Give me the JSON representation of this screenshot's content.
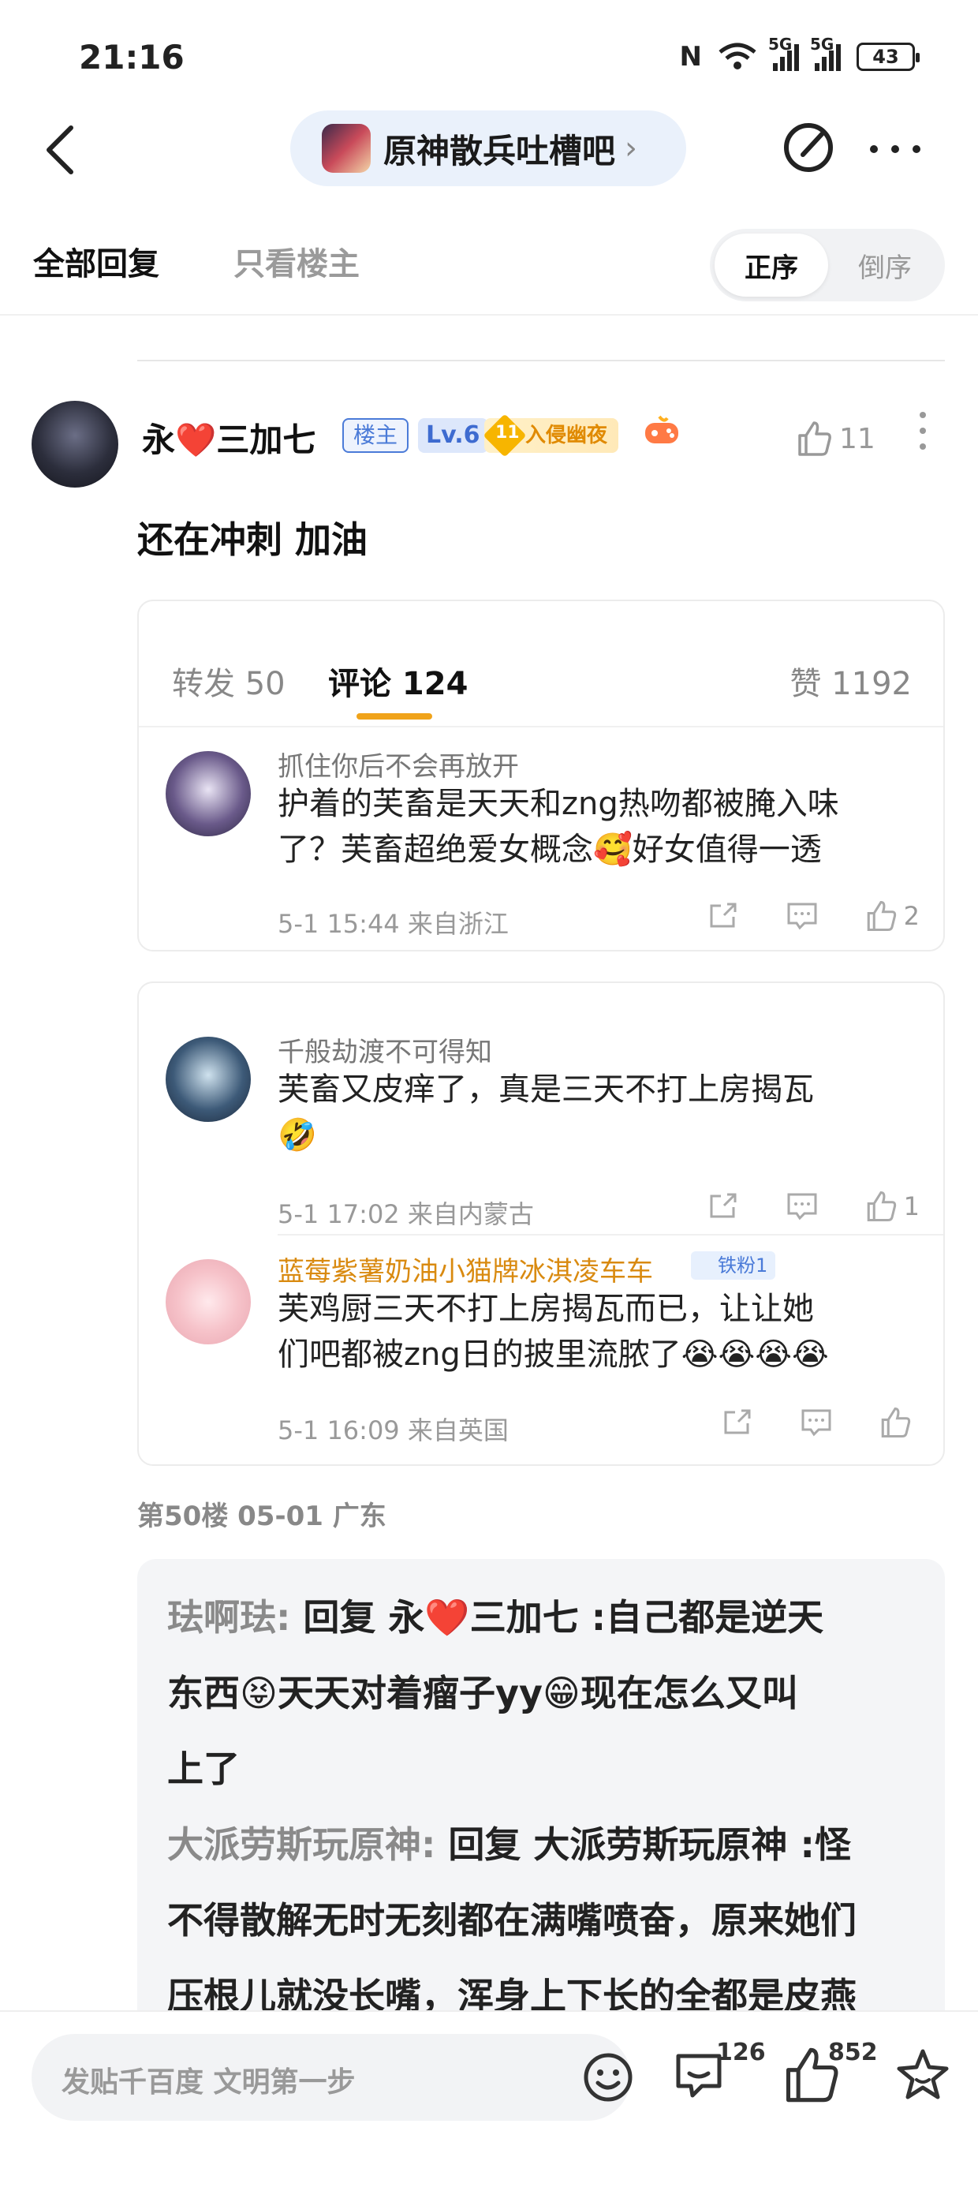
{
  "status": {
    "time": "21:16",
    "net1": "5G",
    "net2": "5G",
    "battery": "43"
  },
  "nav": {
    "forum_name": "原神散兵吐槽吧",
    "chevron": "›"
  },
  "tabs": {
    "all": "全部回复",
    "owner_only": "只看楼主",
    "order_asc": "正序",
    "order_desc": "倒序"
  },
  "post": {
    "username_a": "永",
    "username_heart": "❤️",
    "username_b": "三加七",
    "badge_owner": "楼主",
    "badge_level": "Lv.6",
    "badge_title_num": "11",
    "badge_title": "入侵幽夜",
    "like_count": "11",
    "text": "还在冲刺 加油"
  },
  "shot1": {
    "forward": "转发 50",
    "comment": "评论 124",
    "like": "赞 1192",
    "comment_item": {
      "name": "抓住你后不会再放开",
      "line1": "护着的芙畜是天天和zng热吻都被腌入味",
      "line2": "了？芙畜超绝爱女概念🥰好女值得一透",
      "meta": "5-1 15:44  来自浙江",
      "likes": "2"
    }
  },
  "shot2": {
    "c1": {
      "name": "千般劫渡不可得知",
      "line1": "芙畜又皮痒了，真是三天不打上房揭瓦",
      "line2": "🤣",
      "meta": "5-1 17:02  来自内蒙古",
      "likes": "1"
    },
    "c2": {
      "name": "蓝莓紫薯奶油小猫牌冰淇凌车车",
      "fan_badge": "铁粉1",
      "line1": "芙鸡厨三天不打上房揭瓦而已，让让她",
      "line2": "们吧都被zng日的披里流脓了😭😭😭😭",
      "meta": "5-1 16:09  来自英国"
    }
  },
  "floor": {
    "meta": "第50楼   05-01   广东"
  },
  "replies": [
    {
      "user": "珐啊珐:",
      "text1": " 回复 永❤️三加七 :自己都是逆天",
      "text2": "东西😝天天对着瘤子yy😁现在怎么又叫",
      "text3": "上了"
    },
    {
      "user": "大派劳斯玩原神:",
      "text1": " 回复 大派劳斯玩原神 :怪",
      "text2": "不得散解无时无刻都在满嘴喷奋，原来她们",
      "text3": "压根儿就没长嘴，浑身上下长的全都是皮燕"
    }
  ],
  "bottom": {
    "placeholder": "发贴千百度 文明第一步",
    "comment_count": "126",
    "like_count": "852"
  },
  "icons": [
    "back-icon",
    "edit-icon",
    "more-icon",
    "like-icon",
    "share-icon",
    "comment-icon",
    "emoji-icon",
    "star-icon",
    "gem-icon",
    "game-icon"
  ],
  "colors": {
    "accent_orange": "#f0a31a",
    "owner_blue": "#4b7bd8",
    "heart_red": "#e62b2b"
  }
}
